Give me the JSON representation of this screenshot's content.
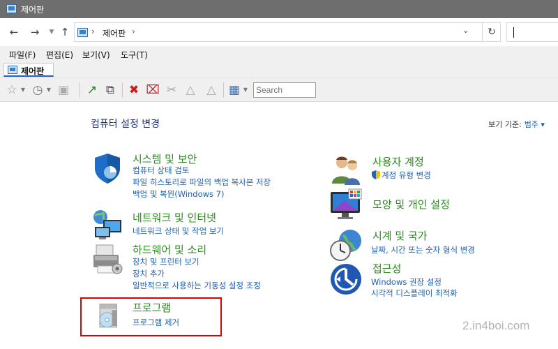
{
  "window": {
    "title": "제어판"
  },
  "address": {
    "crumb": "제어판"
  },
  "menu": [
    "파일(F)",
    "편집(E)",
    "보기(V)",
    "도구(T)"
  ],
  "tab": {
    "label": "제어판"
  },
  "toolbar": {
    "search_placeholder": "Search"
  },
  "page": {
    "title": "컴퓨터 설정 변경",
    "view_by_label": "보기 기준:",
    "view_by_value": "범주 ▾"
  },
  "categories": [
    {
      "title": "시스템 및 보안",
      "icon": "shield-icon",
      "links": [
        "컴퓨터 상태 검토",
        "파일 히스토리로 파일의 백업 복사본 저장",
        "백업 및 복원(Windows 7)"
      ]
    },
    {
      "title": "네트워크 및 인터넷",
      "icon": "network-icon",
      "links": [
        "네트워크 상태 및 작업 보기"
      ]
    },
    {
      "title": "하드웨어 및 소리",
      "icon": "printer-icon",
      "links": [
        "장치 및 프린터 보기",
        "장치 추가",
        "일반적으로 사용하는 기동성 설정 조정"
      ]
    },
    {
      "title": "프로그램",
      "icon": "programs-icon",
      "links": [
        "프로그램 제거"
      ]
    },
    {
      "title": "사용자 계정",
      "icon": "users-icon",
      "links": [
        "계정 유형 변경"
      ]
    },
    {
      "title": "모양 및 개인 설정",
      "icon": "display-icon",
      "links": []
    },
    {
      "title": "시계 및 국가",
      "icon": "clock-globe-icon",
      "links": [
        "날짜, 시간 또는 숫자 형식 변경"
      ]
    },
    {
      "title": "접근성",
      "icon": "accessibility-icon",
      "links": [
        "Windows 권장 설정",
        "시각적 디스플레이 최적화"
      ]
    }
  ],
  "watermark": "2.in4boi.com",
  "colors": {
    "link": "#1a5fb4",
    "category_title": "#2c8a21",
    "highlight": "#e00000"
  }
}
